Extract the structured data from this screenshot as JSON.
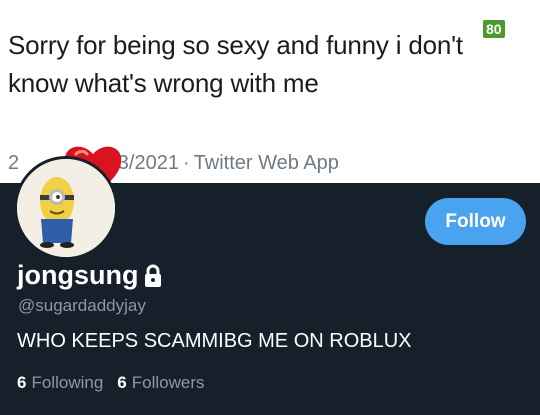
{
  "tweet": {
    "text": "Sorry for being so sexy and funny i don't know what's wrong with me",
    "date_visible": "/03/2021",
    "date_prefix_visible": "2",
    "separator": "·",
    "source": "Twitter Web App",
    "badge": "80"
  },
  "profile": {
    "display_name": "jongsung",
    "handle": "@sugardaddyjay",
    "bio": "WHO KEEPS SCAMMIBG ME ON ROBLUX",
    "follow_label": "Follow",
    "following_count": "6",
    "following_label": "Following",
    "followers_count": "6",
    "followers_label": "Followers",
    "avatar_icon": "minion-avatar",
    "lock_icon": "lock-icon"
  },
  "colors": {
    "profile_bg": "#15202b",
    "follow_button": "#4aa3ef",
    "muted_text": "#8b98a5",
    "heart": "#d8141e"
  }
}
